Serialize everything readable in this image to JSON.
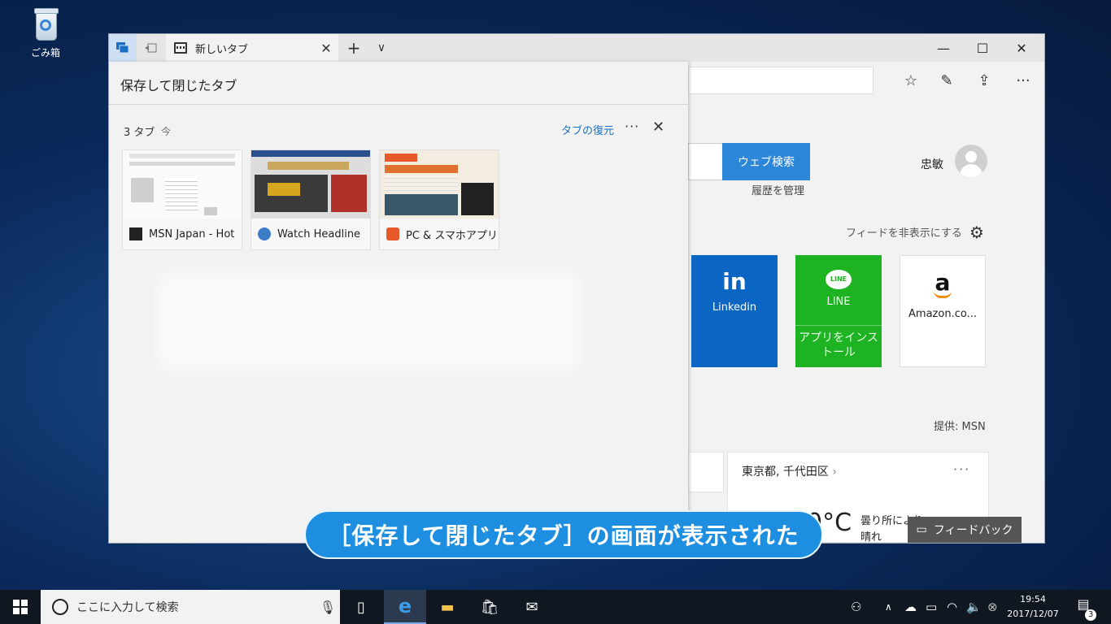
{
  "desktop": {
    "recycle_bin_label": "ごみ箱"
  },
  "browser": {
    "tab_title": "新しいタブ",
    "tab_close": "✕",
    "new_tab": "+",
    "tab_menu": "∨",
    "minimize": "—",
    "maximize": "☐",
    "close": "✕"
  },
  "saved_tabs": {
    "title": "保存して閉じたタブ",
    "group_count": "3 タブ",
    "group_time": "今",
    "restore_label": "タブの復元",
    "more": "···",
    "close": "✕",
    "tabs": [
      {
        "title": "MSN Japan - Hot"
      },
      {
        "title": "Watch Headline"
      },
      {
        "title": "PC & スマホアプリの"
      }
    ]
  },
  "newtab": {
    "web_search_button": "ウェブ検索",
    "manage_history": "履歴を管理",
    "user_name": "忠敏",
    "hide_feed": "フィードを非表示にする",
    "tiles": [
      {
        "logo": "in",
        "name": "Linkedin"
      },
      {
        "logo": "LINE",
        "name": "LINE",
        "sub": "アプリをインストール"
      },
      {
        "logo": "a",
        "name": "Amazon.co..."
      }
    ],
    "provider": "提供: MSN",
    "weather": {
      "location": "東京都, 千代田区",
      "chevron": "›",
      "more": "···",
      "temp": "0°C",
      "condition": "曇り所により晴れ"
    },
    "feedback_button": "フィードバック"
  },
  "subtitle": "［保存して閉じたタブ］の画面が表示された",
  "taskbar": {
    "search_placeholder": "ここに入力して検索",
    "time": "19:54",
    "date": "2017/12/07",
    "notification_count": "3"
  },
  "colors": {
    "accent": "#2d87d8",
    "linkedin": "#0a66c2",
    "line": "#1eb322",
    "subtitle_bg": "#1e8fe0"
  }
}
